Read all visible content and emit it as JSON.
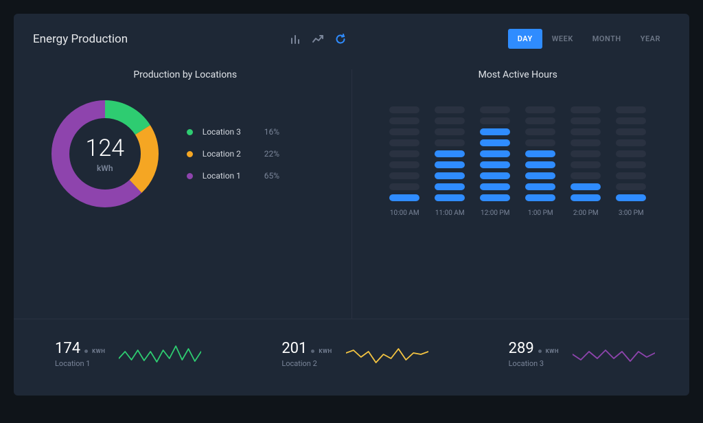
{
  "header": {
    "title": "Energy Production",
    "range": [
      "DAY",
      "WEEK",
      "MONTH",
      "YEAR"
    ],
    "range_active": "DAY"
  },
  "panels": {
    "locations_title": "Production by Locations",
    "hours_title": "Most Active Hours"
  },
  "donut": {
    "value": "124",
    "unit": "kWh"
  },
  "legend": [
    {
      "name": "Location 3",
      "pct": "16%",
      "color": "#2ecc71"
    },
    {
      "name": "Location 2",
      "pct": "22%",
      "color": "#f5a623"
    },
    {
      "name": "Location 1",
      "pct": "65%",
      "color": "#8e44ad"
    }
  ],
  "hours": {
    "labels": [
      "10:00 AM",
      "11:00 AM",
      "12:00 PM",
      "1:00 PM",
      "2:00 PM",
      "3:00 PM"
    ],
    "max_segments": 9,
    "active": [
      1,
      5,
      7,
      5,
      2,
      1
    ]
  },
  "sparks": [
    {
      "value": "174",
      "unit": "KWH",
      "location": "Location 1",
      "color": "#2ecc71",
      "points": [
        10,
        20,
        8,
        22,
        7,
        20,
        5,
        22,
        10,
        28,
        8,
        24,
        6,
        20
      ]
    },
    {
      "value": "201",
      "unit": "KWH",
      "location": "Location 2",
      "color": "#f5c542",
      "points": [
        18,
        22,
        12,
        20,
        4,
        16,
        10,
        24,
        8,
        18,
        16,
        20
      ]
    },
    {
      "value": "289",
      "unit": "KWH",
      "location": "Location 3",
      "color": "#8e44ad",
      "points": [
        16,
        8,
        20,
        10,
        22,
        10,
        20,
        6,
        20,
        12,
        18
      ]
    }
  ],
  "chart_data": [
    {
      "type": "pie",
      "title": "Production by Locations",
      "total_label": "124 kWh",
      "series": [
        {
          "name": "Location 3",
          "value": 16
        },
        {
          "name": "Location 2",
          "value": 22
        },
        {
          "name": "Location 1",
          "value": 65
        }
      ],
      "colors": {
        "Location 1": "#8e44ad",
        "Location 2": "#f5a623",
        "Location 3": "#2ecc71"
      }
    },
    {
      "type": "bar",
      "title": "Most Active Hours",
      "categories": [
        "10:00 AM",
        "11:00 AM",
        "12:00 PM",
        "1:00 PM",
        "2:00 PM",
        "3:00 PM"
      ],
      "values": [
        1,
        5,
        7,
        5,
        2,
        1
      ],
      "ylim": [
        0,
        9
      ],
      "note": "Values are counts of lit segments out of 9; absolute units not shown in image."
    },
    {
      "type": "line",
      "title": "Location 1",
      "value_label": "174 KWH",
      "series": [
        {
          "name": "Location 1",
          "values": [
            10,
            20,
            8,
            22,
            7,
            20,
            5,
            22,
            10,
            28,
            8,
            24,
            6,
            20
          ]
        }
      ],
      "note": "Sparkline; values are relative amplitude estimates (approx), no axes shown."
    },
    {
      "type": "line",
      "title": "Location 2",
      "value_label": "201 KWH",
      "series": [
        {
          "name": "Location 2",
          "values": [
            18,
            22,
            12,
            20,
            4,
            16,
            10,
            24,
            8,
            18,
            16,
            20
          ]
        }
      ],
      "note": "Sparkline; values are relative amplitude estimates (approx)."
    },
    {
      "type": "line",
      "title": "Location 3",
      "value_label": "289 KWH",
      "series": [
        {
          "name": "Location 3",
          "values": [
            16,
            8,
            20,
            10,
            22,
            10,
            20,
            6,
            20,
            12,
            18
          ]
        }
      ],
      "note": "Sparkline; values are relative amplitude estimates (approx)."
    }
  ]
}
